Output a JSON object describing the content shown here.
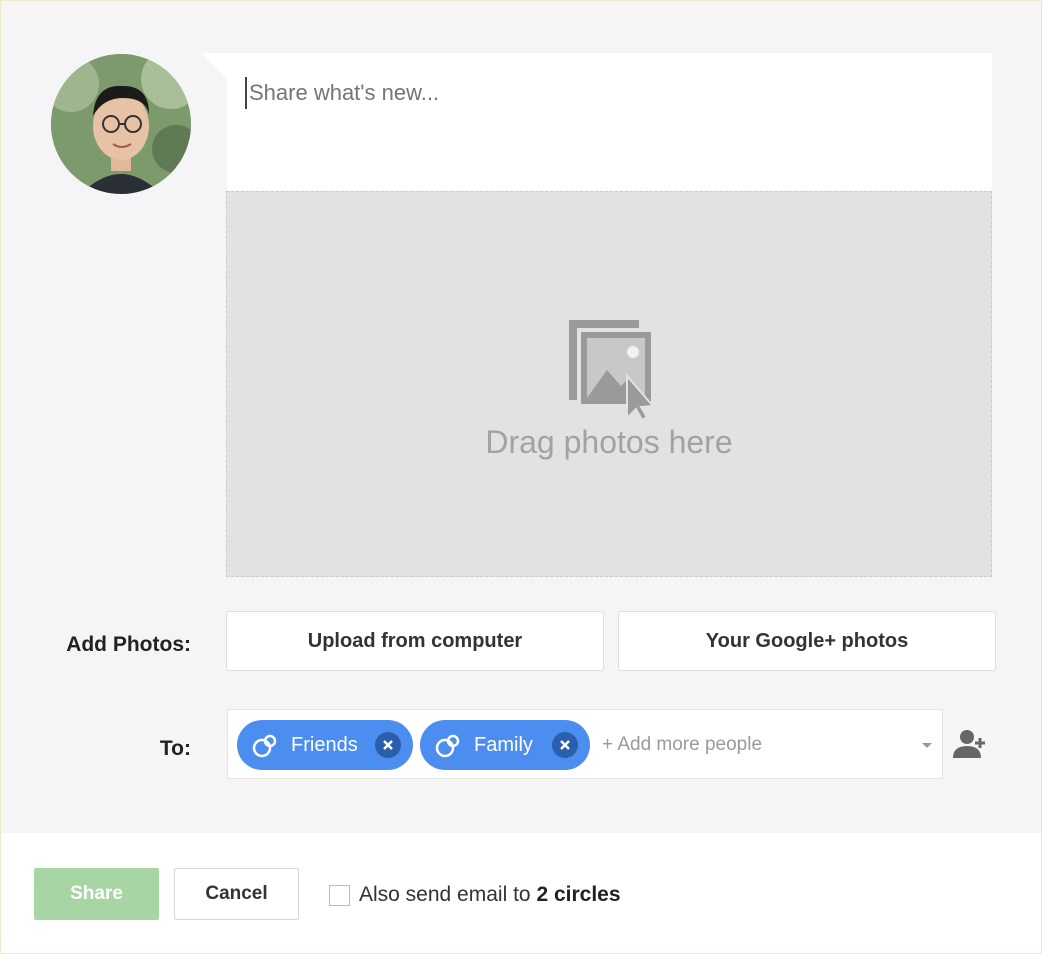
{
  "compose": {
    "placeholder": "Share what's new...",
    "drop_zone_text": "Drag photos here"
  },
  "add_photos": {
    "label": "Add Photos:",
    "upload_button": "Upload from computer",
    "google_photos_button": "Your Google+ photos"
  },
  "audience": {
    "label": "To:",
    "chips": [
      {
        "label": "Friends"
      },
      {
        "label": "Family"
      }
    ],
    "add_more_placeholder": "+ Add more people"
  },
  "footer": {
    "share_button": "Share",
    "cancel_button": "Cancel",
    "email_prefix": "Also send email to",
    "email_target": "2 circles"
  },
  "colors": {
    "chip_blue": "#4c8ef0",
    "share_green": "#a8d5a4",
    "background": "#f5f5f7"
  },
  "icons": {
    "avatar": "user-photo",
    "drop_zone": "photos-drag-icon",
    "chip": "circles-icon",
    "chip_remove": "close-circle-icon",
    "add_person": "person-add-icon"
  }
}
